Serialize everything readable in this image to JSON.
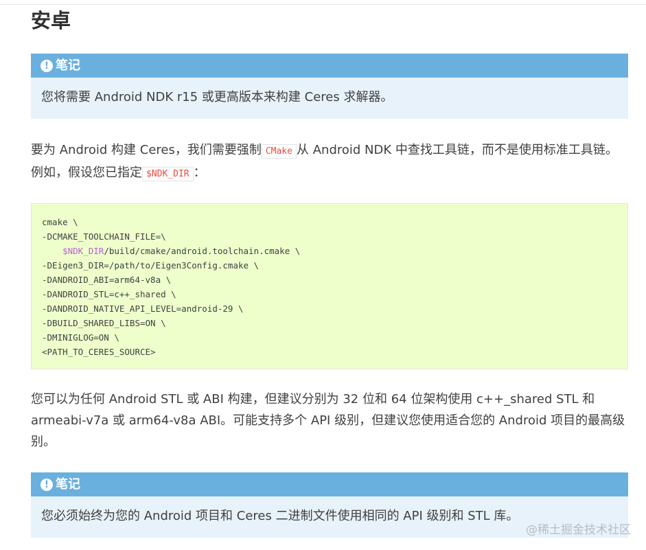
{
  "heading": "安卓",
  "note1": {
    "title": "笔记",
    "icon": "exclamation-circle-icon",
    "text": "您将需要 Android NDK r15 或更高版本来构建 Ceres 求解器。"
  },
  "para1": {
    "text_before": "要为 Android 构建 Ceres，我们需要强制",
    "code1": "CMake",
    "text_middle": "从 Android NDK 中查找工具链，而不是使用标准工具链。例如，假设您已指定",
    "code2": "$NDK_DIR",
    "text_after": "："
  },
  "code_block": {
    "lines": [
      "cmake \\",
      "-DCMAKE_TOOLCHAIN_FILE=\\",
      "    ",
      "-DEigen3_DIR=/path/to/Eigen3Config.cmake \\",
      "-DANDROID_ABI=arm64-v8a \\",
      "-DANDROID_STL=c++_shared \\",
      "-DANDROID_NATIVE_API_LEVEL=android-29 \\",
      "-DBUILD_SHARED_LIBS=ON \\",
      "-DMINIGLOG=ON \\",
      "<PATH_TO_CERES_SOURCE>"
    ],
    "line3_var": "$NDK_DIR",
    "line3_rest": "/build/cmake/android.toolchain.cmake \\"
  },
  "para2": {
    "text": "您可以为任何 Android STL 或 ABI 构建，但建议分别为 32 位和 64 位架构使用 c++_shared STL 和 armeabi-v7a 或 arm64-v8a ABI。可能支持多个 API 级别，但建议您使用适合您的 Android 项目的最高级别。"
  },
  "note2": {
    "title": "笔记",
    "icon": "exclamation-circle-icon",
    "text": "您必须始终为您的 Android 项目和 Ceres 二进制文件使用相同的 API 级别和 STL 库。"
  },
  "watermark": "@稀土掘金技术社区",
  "colors": {
    "admonition_title_bg": "#6ab0de",
    "admonition_body_bg": "#e7f2fa",
    "code_block_bg": "#eeffcc",
    "inline_code": "#e74c3c",
    "code_variable": "#bb60d5"
  }
}
